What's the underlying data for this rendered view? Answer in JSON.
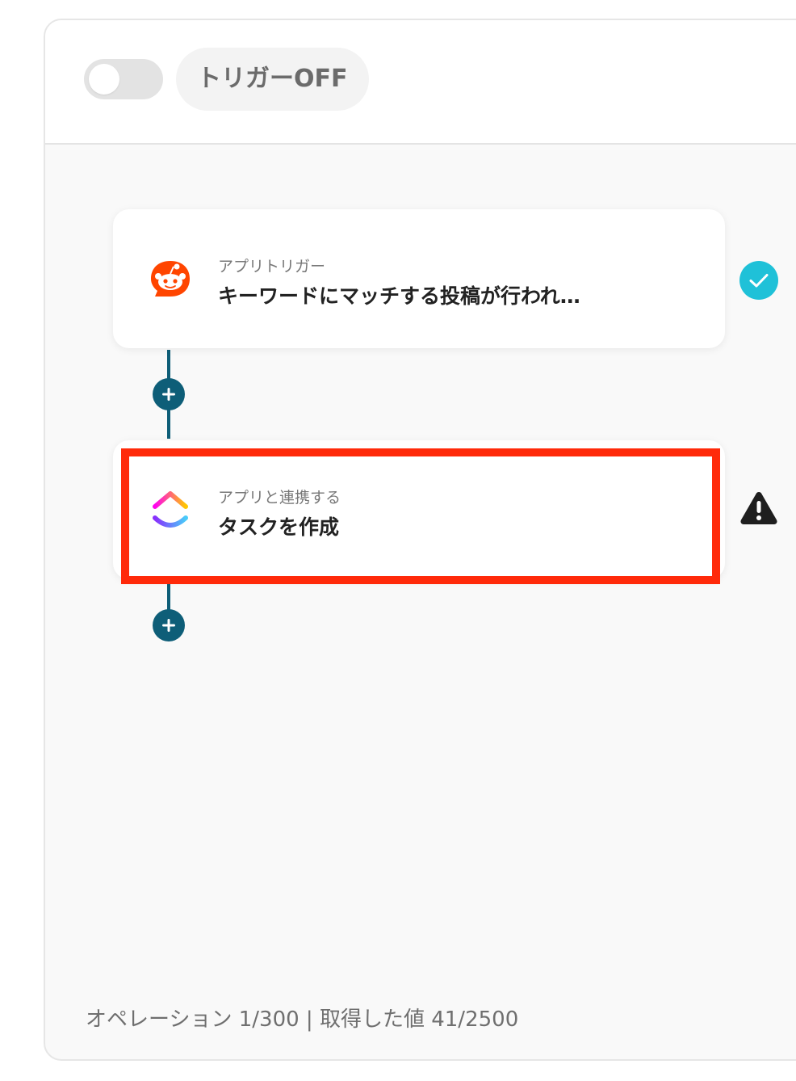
{
  "trigger": {
    "toggle_state": "off",
    "label": "トリガーOFF"
  },
  "steps": [
    {
      "app": "Reddit",
      "icon": "reddit-icon",
      "subtitle": "アプリトリガー",
      "title": "キーワードにマッチする投稿が行われ…",
      "status": "complete",
      "status_icon": "check-circle-icon"
    },
    {
      "app": "ClickUp",
      "icon": "clickup-icon",
      "subtitle": "アプリと連携する",
      "title": "タスクを作成",
      "status": "warning",
      "status_icon": "warning-triangle-icon",
      "highlighted": true
    }
  ],
  "footer": {
    "text": "オペレーション 1/300 | 取得した値 41/2500"
  },
  "colors": {
    "connector": "#0e5e78",
    "highlight": "#ff2a0a",
    "check": "#1fc1d8",
    "reddit": "#ff4500"
  }
}
